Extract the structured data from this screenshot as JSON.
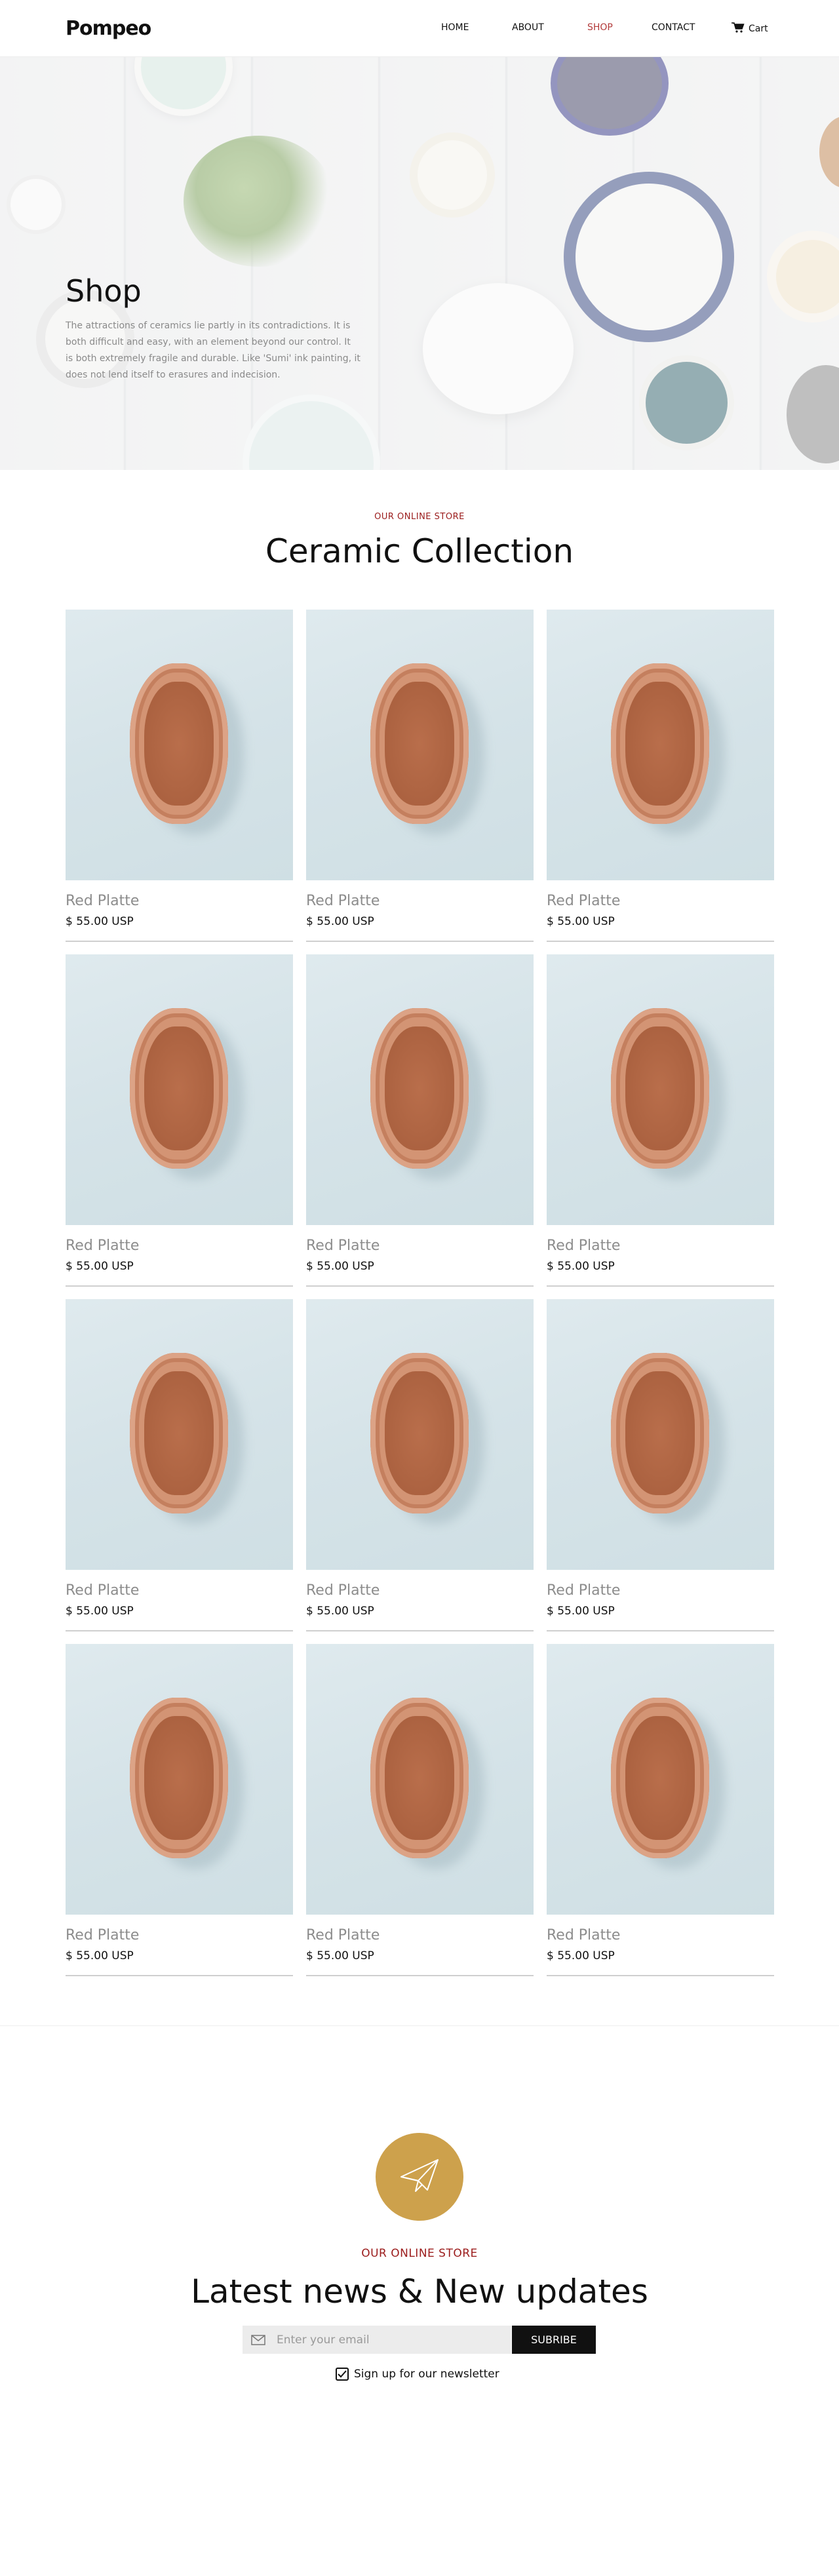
{
  "header": {
    "logo": "Pompeo",
    "nav": [
      {
        "label": "HOME",
        "active": false
      },
      {
        "label": "ABOUT",
        "active": false
      },
      {
        "label": "SHOP",
        "active": true
      },
      {
        "label": "CONTACT",
        "active": false
      }
    ],
    "cart_label": "Cart",
    "cart_icon": "cart-icon",
    "active_color": "#b23a3a"
  },
  "hero": {
    "title": "Shop",
    "description": "The attractions of ceramics lie partly in its contradictions. It is both difficult and easy, with an element beyond our control. It is both extremely fragile and durable. Like 'Sumi' ink painting, it does not lend itself to erasures and indecision."
  },
  "collection": {
    "eyebrow": "OUR ONLINE STORE",
    "title": "Ceramic Collection",
    "accent_color": "#9b1c1c",
    "products": [
      {
        "name": "Red Platte",
        "price": "$ 55.00 USP"
      },
      {
        "name": "Red Platte",
        "price": "$ 55.00 USP"
      },
      {
        "name": "Red Platte",
        "price": "$ 55.00 USP"
      },
      {
        "name": "Red Platte",
        "price": "$ 55.00 USP"
      },
      {
        "name": "Red Platte",
        "price": "$ 55.00 USP"
      },
      {
        "name": "Red Platte",
        "price": "$ 55.00 USP"
      },
      {
        "name": "Red Platte",
        "price": "$ 55.00 USP"
      },
      {
        "name": "Red Platte",
        "price": "$ 55.00 USP"
      },
      {
        "name": "Red Platte",
        "price": "$ 55.00 USP"
      },
      {
        "name": "Red Platte",
        "price": "$ 55.00 USP"
      },
      {
        "name": "Red Platte",
        "price": "$ 55.00 USP"
      },
      {
        "name": "Red Platte",
        "price": "$ 55.00 USP"
      }
    ]
  },
  "newsletter": {
    "badge_icon": "paper-plane-icon",
    "badge_color": "#cda14c",
    "eyebrow": "OUR ONLINE STORE",
    "title": "Latest news & New updates",
    "email_placeholder": "Enter your email",
    "email_icon": "mail-icon",
    "subscribe_label": "SUBRIBE",
    "checkbox_label": "Sign up for our newsletter",
    "checkbox_checked": true
  }
}
